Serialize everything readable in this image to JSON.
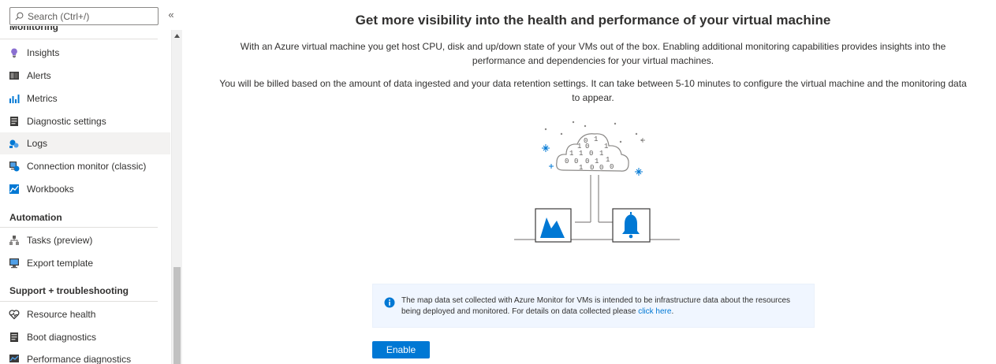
{
  "search": {
    "placeholder": "Search (Ctrl+/)"
  },
  "sidebar": {
    "collapse_icon": "«",
    "sections": [
      {
        "header": "Monitoring",
        "items": [
          {
            "label": "Insights",
            "icon": "insights-icon"
          },
          {
            "label": "Alerts",
            "icon": "alerts-icon"
          },
          {
            "label": "Metrics",
            "icon": "metrics-icon"
          },
          {
            "label": "Diagnostic settings",
            "icon": "diagnostic-settings-icon"
          },
          {
            "label": "Logs",
            "icon": "logs-icon",
            "active": true
          },
          {
            "label": "Connection monitor (classic)",
            "icon": "connection-monitor-icon"
          },
          {
            "label": "Workbooks",
            "icon": "workbooks-icon"
          }
        ]
      },
      {
        "header": "Automation",
        "items": [
          {
            "label": "Tasks (preview)",
            "icon": "tasks-icon"
          },
          {
            "label": "Export template",
            "icon": "export-template-icon"
          }
        ]
      },
      {
        "header": "Support + troubleshooting",
        "items": [
          {
            "label": "Resource health",
            "icon": "resource-health-icon"
          },
          {
            "label": "Boot diagnostics",
            "icon": "boot-diagnostics-icon"
          },
          {
            "label": "Performance diagnostics",
            "icon": "performance-diagnostics-icon"
          }
        ]
      }
    ]
  },
  "main": {
    "title": "Get more visibility into the health and performance of your virtual machine",
    "paragraph1": "With an Azure virtual machine you get host CPU, disk and up/down state of your VMs out of the box.  Enabling additional monitoring capabilities provides insights into the performance and dependencies for your virtual machines.",
    "paragraph2": "You will be billed based on the amount of data ingested and your data retention settings. It can take between 5-10 minutes to configure the virtual machine and the monitoring data to appear.",
    "info_text": "The map data set collected with Azure Monitor for VMs is intended to be infrastructure data about the resources being deployed and monitored. For details on data collected please ",
    "info_link": "click here",
    "info_period": ".",
    "enable_label": "Enable"
  },
  "colors": {
    "accent": "#0078d4",
    "info_bg": "#f0f6ff",
    "active_item": "#f3f2f1"
  }
}
